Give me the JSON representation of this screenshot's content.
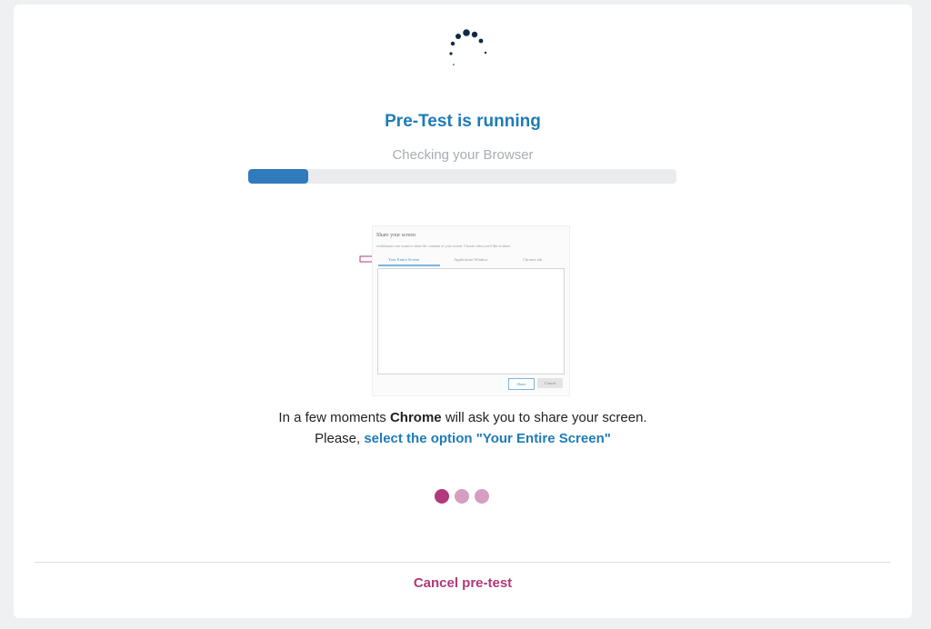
{
  "status": {
    "title": "Pre-Test is running",
    "subtitle": "Checking your Browser",
    "progress_percent": 14
  },
  "illustration": {
    "dialog_title": "Share your screen",
    "dialog_description": "workfusion.com wants to share the contents of your screen. Choose what you'd like to share.",
    "tabs": [
      "Your Entire Screen",
      "Application Window",
      "Chrome tab"
    ],
    "share_label": "Share",
    "cancel_label": "Cancel"
  },
  "instructions": {
    "line1_prefix": "In a few moments ",
    "browser_name": "Chrome",
    "line1_suffix": " will ask you to share your screen.",
    "line2_prefix": "Please, ",
    "line2_option": "select the option \"Your Entire Screen\""
  },
  "step_indicator": {
    "total": 3,
    "active_index": 0
  },
  "footer": {
    "cancel_label": "Cancel pre-test"
  },
  "colors": {
    "accent_blue": "#1f7bb8",
    "progress_fill": "#2f7bbb",
    "magenta": "#b03a7a",
    "magenta_light": "#d59ec0",
    "spinner": "#0f2a44"
  }
}
